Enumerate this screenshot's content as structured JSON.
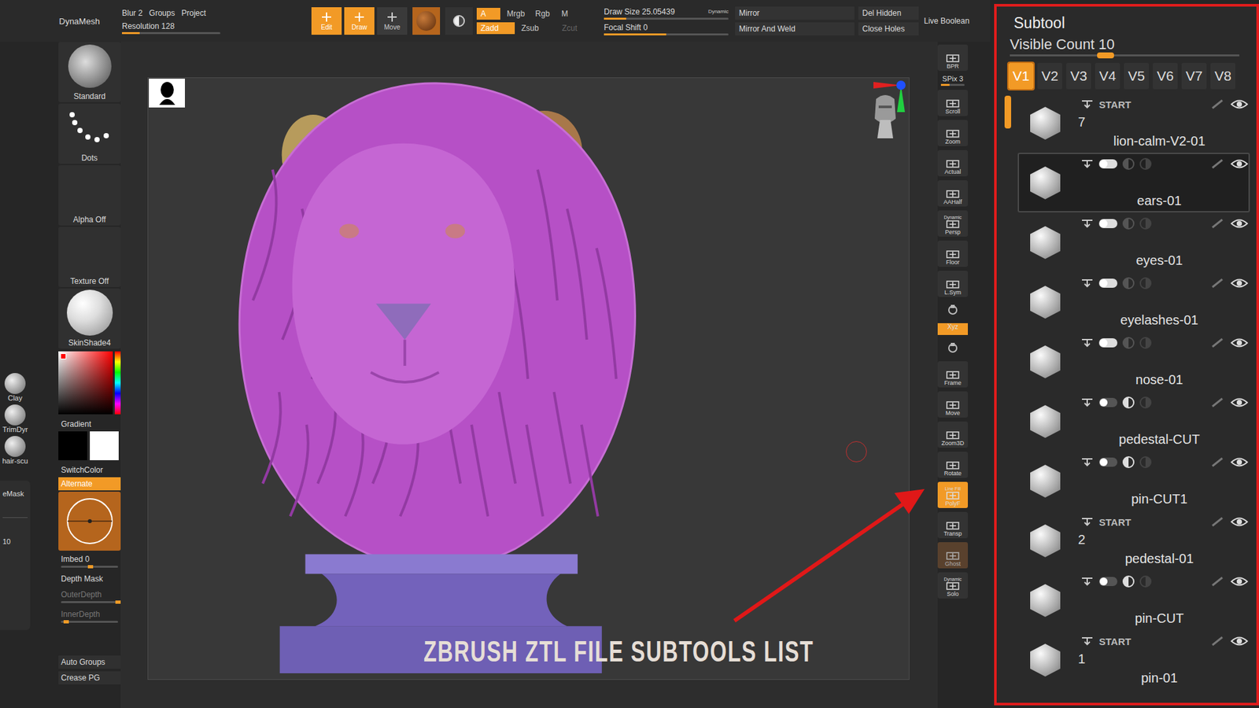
{
  "topbar": {
    "dynamesh": "DynaMesh",
    "blur": "Blur 2",
    "groups": "Groups",
    "project": "Project",
    "resolution": {
      "label": "Resolution 128",
      "level": 0.18
    },
    "tool_buttons": [
      {
        "label": "Edit",
        "selected": true
      },
      {
        "label": "Draw",
        "selected": true
      },
      {
        "label": "Move",
        "selected": false
      }
    ],
    "channels": [
      {
        "label": "A",
        "selected": true
      },
      {
        "label": "Mrgb",
        "selected": false
      },
      {
        "label": "Rgb",
        "selected": false
      },
      {
        "label": "M",
        "selected": false
      }
    ],
    "modes": [
      {
        "label": "Zadd",
        "selected": true,
        "disabled": false
      },
      {
        "label": "Zsub",
        "selected": false,
        "disabled": false
      },
      {
        "label": "Zcut",
        "selected": false,
        "disabled": true
      }
    ],
    "draw_size": {
      "label": "Draw Size 25.05439",
      "badge": "Dynamic",
      "level": 0.18
    },
    "focal_shift": {
      "label": "Focal Shift 0",
      "level": 0.5
    },
    "mirror": [
      "Mirror",
      "Mirror And Weld"
    ],
    "geometry": [
      "Del Hidden",
      "Close Holes"
    ],
    "live_boolean": "Live Boolean"
  },
  "quick_brushes": {
    "items": [
      "Clay",
      "TrimDyr",
      "hair-scu"
    ],
    "mask": "eMask",
    "value": "10"
  },
  "left_panel": {
    "tiles": [
      {
        "label": "Standard",
        "kind": "brush"
      },
      {
        "label": "Dots",
        "kind": "stroke"
      },
      {
        "label": "Alpha Off",
        "kind": "empty"
      },
      {
        "label": "Texture Off",
        "kind": "empty"
      },
      {
        "label": "SkinShade4",
        "kind": "material"
      }
    ],
    "gradient": "Gradient",
    "switch_color": "SwitchColor",
    "alternate": {
      "label": "Alternate",
      "selected": true
    },
    "imbed": {
      "label": "Imbed 0",
      "level": 0.47
    },
    "depth": [
      {
        "label": "Depth Mask",
        "kind": "toggle",
        "disabled": false,
        "level": 0
      },
      {
        "label": "OuterDepth",
        "kind": "slider",
        "disabled": true,
        "level": 0.95
      },
      {
        "label": "InnerDepth",
        "kind": "slider",
        "disabled": true,
        "level": 0.05
      }
    ],
    "buttons": [
      "Auto Groups",
      "Crease PG"
    ]
  },
  "canvas": {
    "caption": "ZBRUSH ZTL FILE SUBTOOLS LIST"
  },
  "shelf": [
    {
      "label": "BPR",
      "kind": "button",
      "selected": false,
      "disabled": false,
      "badge": ""
    },
    {
      "label": "SPix 3",
      "kind": "slider",
      "selected": false,
      "disabled": false,
      "badge": "",
      "level": 0.35
    },
    {
      "label": "Scroll",
      "kind": "button",
      "selected": false,
      "disabled": false,
      "badge": ""
    },
    {
      "label": "Zoom",
      "kind": "button",
      "selected": false,
      "disabled": false,
      "badge": ""
    },
    {
      "label": "Actual",
      "kind": "button",
      "selected": false,
      "disabled": false,
      "badge": ""
    },
    {
      "label": "AAHalf",
      "kind": "button",
      "selected": false,
      "disabled": false,
      "badge": ""
    },
    {
      "label": "Persp",
      "kind": "button",
      "selected": false,
      "disabled": false,
      "badge": "Dynamic"
    },
    {
      "label": "Floor",
      "kind": "button",
      "selected": false,
      "disabled": false,
      "badge": ""
    },
    {
      "label": "L.Sym",
      "kind": "button",
      "selected": false,
      "disabled": false,
      "badge": ""
    },
    {
      "label": "",
      "kind": "icon",
      "selected": false,
      "disabled": false,
      "badge": ""
    },
    {
      "label": "Xyz",
      "kind": "small",
      "selected": true,
      "disabled": false,
      "badge": ""
    },
    {
      "label": "",
      "kind": "icon",
      "selected": false,
      "disabled": false,
      "badge": ""
    },
    {
      "label": "Frame",
      "kind": "button",
      "selected": false,
      "disabled": false,
      "badge": ""
    },
    {
      "label": "Move",
      "kind": "button",
      "selected": false,
      "disabled": false,
      "badge": ""
    },
    {
      "label": "Zoom3D",
      "kind": "button",
      "selected": false,
      "disabled": false,
      "badge": ""
    },
    {
      "label": "Rotate",
      "kind": "button",
      "selected": false,
      "disabled": false,
      "badge": ""
    },
    {
      "label": "PolyF",
      "kind": "button",
      "selected": true,
      "disabled": false,
      "badge": "Line Fill"
    },
    {
      "label": "Transp",
      "kind": "button",
      "selected": false,
      "disabled": false,
      "badge": ""
    },
    {
      "label": "Ghost",
      "kind": "button",
      "selected": false,
      "disabled": true,
      "badge": ""
    },
    {
      "label": "Solo",
      "kind": "button",
      "selected": false,
      "disabled": false,
      "badge": "Dynamic"
    }
  ],
  "subtool": {
    "title": "Subtool",
    "visible_count": {
      "label": "Visible Count 10",
      "level": 0.38
    },
    "tabs": [
      {
        "label": "V1",
        "selected": true
      },
      {
        "label": "V2",
        "selected": false
      },
      {
        "label": "V3",
        "selected": false
      },
      {
        "label": "V4",
        "selected": false
      },
      {
        "label": "V5",
        "selected": false
      },
      {
        "label": "V6",
        "selected": false
      },
      {
        "label": "V7",
        "selected": false
      },
      {
        "label": "V8",
        "selected": false
      }
    ],
    "items": [
      {
        "name": "lion-calm-V2-01",
        "kind": "folder",
        "label": "START",
        "count": "7",
        "selected": false,
        "visible": true
      },
      {
        "name": "ears-01",
        "kind": "subtool",
        "selected": true,
        "visible": true,
        "subtract": false
      },
      {
        "name": "eyes-01",
        "kind": "subtool",
        "selected": false,
        "visible": true,
        "subtract": false
      },
      {
        "name": "eyelashes-01",
        "kind": "subtool",
        "selected": false,
        "visible": true,
        "subtract": false
      },
      {
        "name": "nose-01",
        "kind": "subtool",
        "selected": false,
        "visible": true,
        "subtract": false
      },
      {
        "name": "pedestal-CUT",
        "kind": "subtool",
        "selected": false,
        "visible": true,
        "subtract": true
      },
      {
        "name": "pin-CUT1",
        "kind": "subtool",
        "selected": false,
        "visible": true,
        "subtract": true
      },
      {
        "name": "pedestal-01",
        "kind": "folder",
        "label": "START",
        "count": "2",
        "selected": false,
        "visible": true
      },
      {
        "name": "pin-CUT",
        "kind": "subtool",
        "selected": false,
        "visible": true,
        "subtract": true
      },
      {
        "name": "pin-01",
        "kind": "folder",
        "label": "START",
        "count": "1",
        "selected": false,
        "visible": true
      }
    ]
  }
}
